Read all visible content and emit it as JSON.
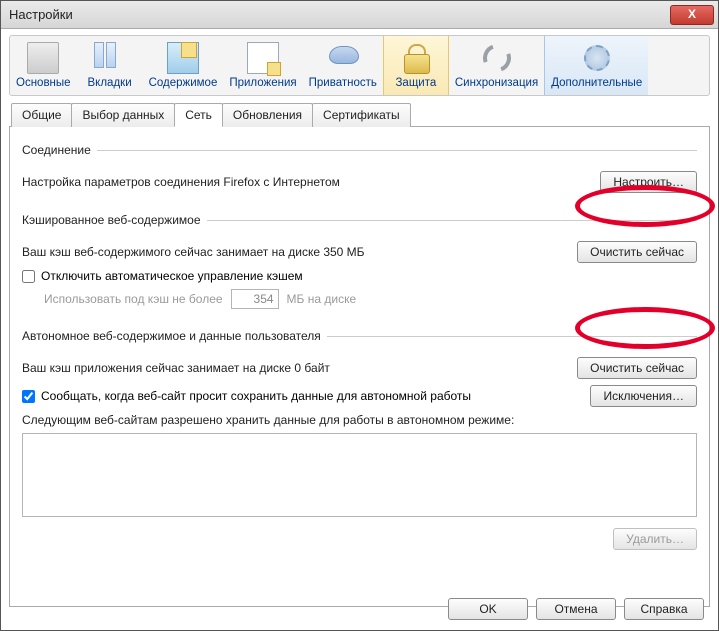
{
  "window": {
    "title": "Настройки",
    "close": "X"
  },
  "toolbar": [
    {
      "key": "basic",
      "label": "Основные"
    },
    {
      "key": "tabs",
      "label": "Вкладки"
    },
    {
      "key": "content",
      "label": "Содержимое"
    },
    {
      "key": "apps",
      "label": "Приложения"
    },
    {
      "key": "privacy",
      "label": "Приватность"
    },
    {
      "key": "security",
      "label": "Защита"
    },
    {
      "key": "sync",
      "label": "Синхронизация"
    },
    {
      "key": "advanced",
      "label": "Дополнительные"
    }
  ],
  "toolbar_active_index": 5,
  "toolbar_highlight_index": 7,
  "tabs": [
    {
      "label": "Общие"
    },
    {
      "label": "Выбор данных"
    },
    {
      "label": "Сеть"
    },
    {
      "label": "Обновления"
    },
    {
      "label": "Сертификаты"
    }
  ],
  "tabs_active_index": 2,
  "connection": {
    "legend": "Соединение",
    "text": "Настройка параметров соединения Firefox с Интернетом",
    "button": "Настроить…"
  },
  "cache": {
    "legend": "Кэшированное веб-содержимое",
    "text": "Ваш кэш веб-содержимого сейчас занимает на диске 350 МБ",
    "clear_button": "Очистить сейчас",
    "disable_checkbox_label": "Отключить автоматическое управление кэшем",
    "disable_checked": false,
    "limit_label_before": "Использовать под кэш не более",
    "limit_value": "354",
    "limit_label_after": "МБ на диске"
  },
  "offline": {
    "legend": "Автономное веб-содержимое и данные пользователя",
    "text": "Ваш кэш приложения сейчас занимает на диске 0 байт",
    "clear_button": "Очистить сейчас",
    "notify_checkbox_label": "Сообщать, когда веб-сайт просит сохранить данные для автономной работы",
    "notify_checked": true,
    "exceptions_button": "Исключения…",
    "sites_label": "Следующим веб-сайтам разрешено хранить данные для работы в автономном режиме:",
    "delete_button": "Удалить…"
  },
  "dialog_buttons": {
    "ok": "OK",
    "cancel": "Отмена",
    "help": "Справка"
  }
}
